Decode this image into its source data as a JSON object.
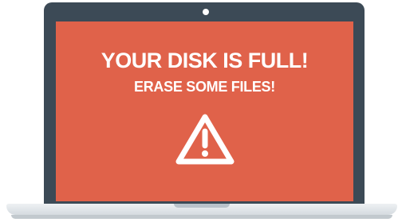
{
  "screen": {
    "headline": "YOUR DISK IS FULL!",
    "subline": "ERASE SOME FILES!"
  },
  "icons": {
    "warning": "warning-triangle-icon",
    "camera": "webcam-icon"
  },
  "colors": {
    "screen_background": "#e0624a",
    "bezel": "#3c4a56",
    "text": "#ffffff",
    "base": "#d5dbe0"
  }
}
